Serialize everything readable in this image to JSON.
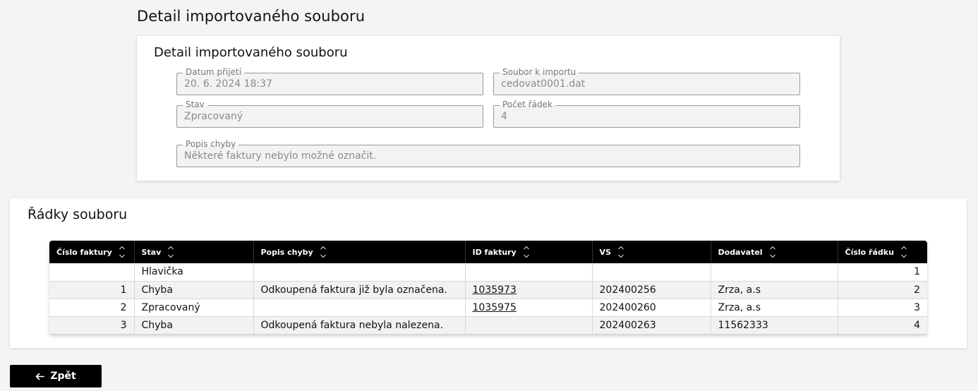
{
  "page": {
    "title": "Detail importovaného souboru"
  },
  "detail": {
    "title": "Detail importovaného souboru",
    "fields": {
      "datum": {
        "label": "Datum přijetí",
        "value": "20. 6. 2024 18:37"
      },
      "soubor": {
        "label": "Soubor k importu",
        "value": "cedovat0001.dat"
      },
      "stav": {
        "label": "Stav",
        "value": "Zpracovaný"
      },
      "pocet": {
        "label": "Počet řádek",
        "value": "4"
      },
      "popis": {
        "label": "Popis chyby",
        "value": "Některé faktury nebylo možné označit."
      }
    }
  },
  "rows": {
    "title": "Řádky souboru",
    "columns": [
      "Číslo faktury",
      "Stav",
      "Popis chyby",
      "ID faktury",
      "VS",
      "Dodavatel",
      "Číslo řádku"
    ],
    "data": [
      [
        "",
        "Hlavička",
        "",
        "",
        "",
        "",
        "1"
      ],
      [
        "1",
        "Chyba",
        "Odkoupená faktura již byla označena.",
        "1035973",
        "202400256",
        "Zrza, a.s",
        "2"
      ],
      [
        "2",
        "Zpracovaný",
        "",
        "1035975",
        "202400260",
        "Zrza, a.s",
        "3"
      ],
      [
        "3",
        "Chyba",
        "Odkoupená faktura nebyla nalezena.",
        "",
        "202400263",
        "11562333",
        "4"
      ]
    ]
  },
  "back_button": {
    "label": "Zpět",
    "icon": "arrow-left-icon"
  }
}
